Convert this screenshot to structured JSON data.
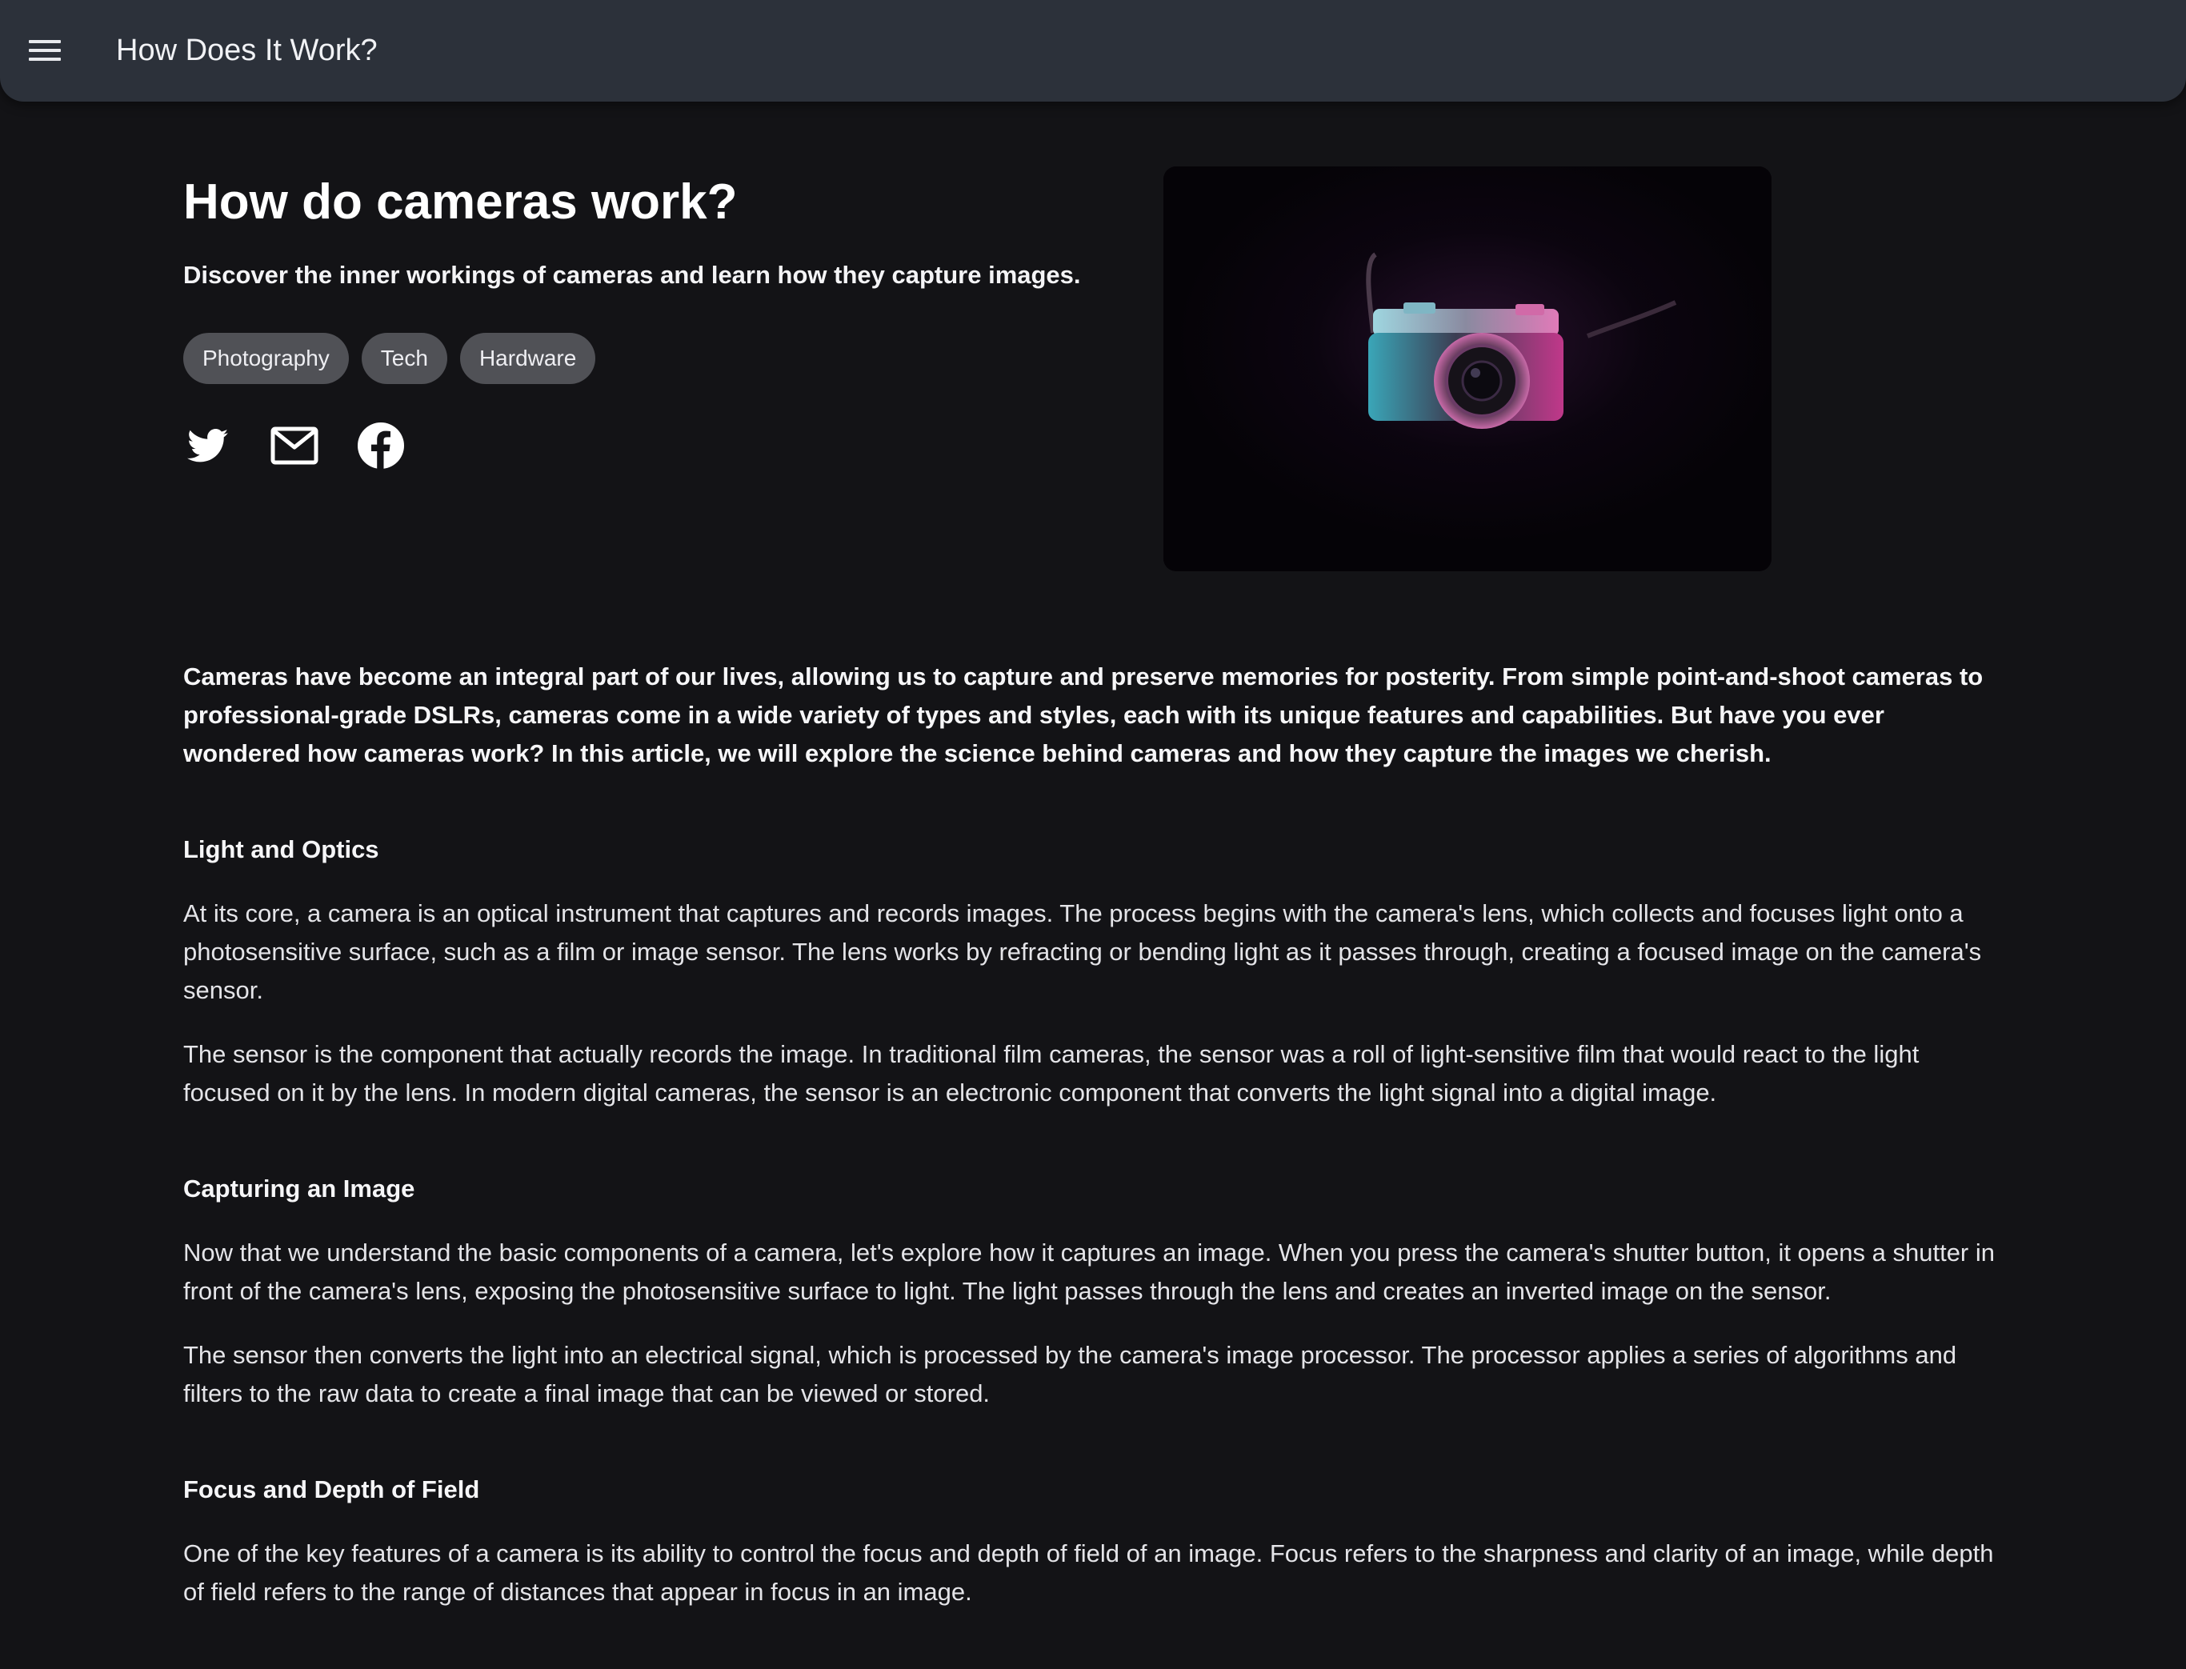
{
  "appbar": {
    "title": "How Does It Work?",
    "menu_icon": "hamburger-menu-icon"
  },
  "hero": {
    "title": "How do cameras work?",
    "subtitle": "Discover the inner workings of cameras and learn how they capture images.",
    "tags": [
      "Photography",
      "Tech",
      "Hardware"
    ],
    "share_icons": [
      "twitter-icon",
      "email-icon",
      "facebook-icon"
    ],
    "image_subject": "camera-photo"
  },
  "article": {
    "intro": "Cameras have become an integral part of our lives, allowing us to capture and preserve memories for posterity. From simple point-and-shoot cameras to professional-grade DSLRs, cameras come in a wide variety of types and styles, each with its unique features and capabilities. But have you ever wondered how cameras work? In this article, we will explore the science behind cameras and how they capture the images we cherish.",
    "sections": [
      {
        "heading": "Light and Optics",
        "paragraphs": [
          "At its core, a camera is an optical instrument that captures and records images. The process begins with the camera's lens, which collects and focuses light onto a photosensitive surface, such as a film or image sensor. The lens works by refracting or bending light as it passes through, creating a focused image on the camera's sensor.",
          "The sensor is the component that actually records the image. In traditional film cameras, the sensor was a roll of light-sensitive film that would react to the light focused on it by the lens. In modern digital cameras, the sensor is an electronic component that converts the light signal into a digital image."
        ]
      },
      {
        "heading": "Capturing an Image",
        "paragraphs": [
          "Now that we understand the basic components of a camera, let's explore how it captures an image. When you press the camera's shutter button, it opens a shutter in front of the camera's lens, exposing the photosensitive surface to light. The light passes through the lens and creates an inverted image on the sensor.",
          "The sensor then converts the light into an electrical signal, which is processed by the camera's image processor. The processor applies a series of algorithms and filters to the raw data to create a final image that can be viewed or stored."
        ]
      },
      {
        "heading": "Focus and Depth of Field",
        "paragraphs": [
          "One of the key features of a camera is its ability to control the focus and depth of field of an image. Focus refers to the sharpness and clarity of an image, while depth of field refers to the range of distances that appear in focus in an image."
        ]
      }
    ]
  },
  "colors": {
    "background": "#131316",
    "appbar": "#2c313a",
    "tag_background": "#505156",
    "text": "#ffffff"
  }
}
